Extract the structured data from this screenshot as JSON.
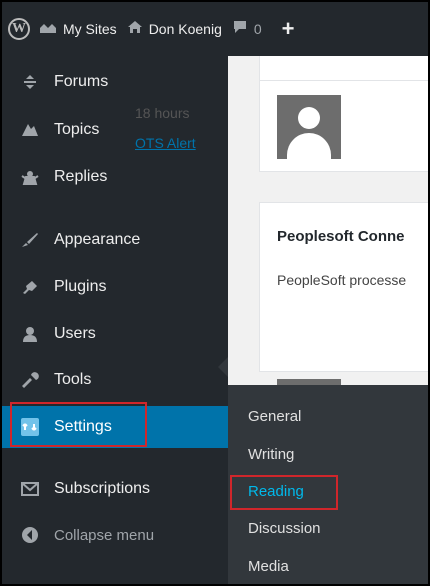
{
  "admin_bar": {
    "my_sites": "My Sites",
    "site_name": "Don Koenig",
    "comment_count": "0"
  },
  "sidebar": {
    "items": [
      {
        "label": "Forums",
        "icon": "forums-icon"
      },
      {
        "label": "Topics",
        "icon": "topics-icon"
      },
      {
        "label": "Replies",
        "icon": "replies-icon"
      },
      {
        "label": "Appearance",
        "icon": "appearance-icon"
      },
      {
        "label": "Plugins",
        "icon": "plugins-icon"
      },
      {
        "label": "Users",
        "icon": "users-icon"
      },
      {
        "label": "Tools",
        "icon": "tools-icon"
      },
      {
        "label": "Settings",
        "icon": "settings-icon"
      },
      {
        "label": "Subscriptions",
        "icon": "envelope-icon"
      }
    ],
    "collapse_label": "Collapse menu"
  },
  "settings_submenu": {
    "items": [
      "General",
      "Writing",
      "Reading",
      "Discussion",
      "Media"
    ],
    "active": "Reading"
  },
  "content": {
    "activity_time": "18 hours",
    "activity_link": "OTS Alert",
    "post_title": "Peoplesoft Conne",
    "post_excerpt": "PeopleSoft processe"
  },
  "colors": {
    "sidebar_bg": "#23282d",
    "current_item": "#0073aa",
    "submenu_bg": "#32373c",
    "active_submenu_text": "#00b9eb",
    "highlight_box": "#d0262b"
  }
}
